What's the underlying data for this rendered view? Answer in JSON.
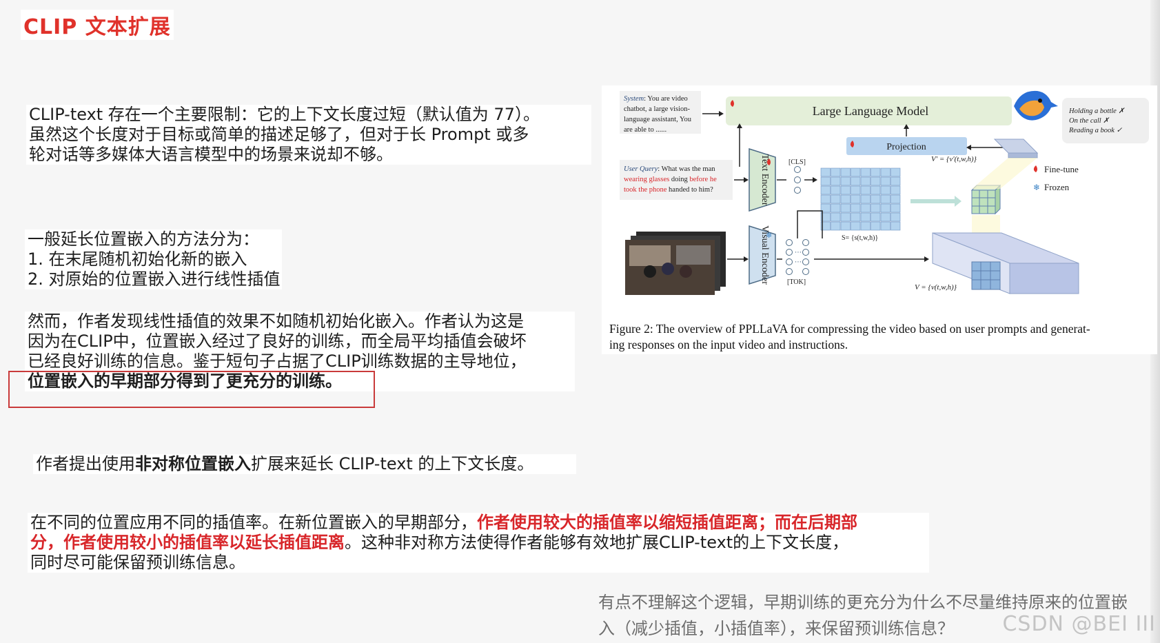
{
  "slide": {
    "title": "CLIP 文本扩展",
    "p1": {
      "lines": [
        "CLIP-text 存在一个主要限制：它的上下文长度过短（默认值为 77）。",
        "虽然这个长度对于目标或简单的描述足够了，但对于长 Prompt 或多",
        "轮对话等多媒体大语言模型中的场景来说却不够。"
      ]
    },
    "p2": {
      "lines": [
        "一般延长位置嵌入的方法分为：",
        "1. 在末尾随机初始化新的嵌入",
        "2.  对原始的位置嵌入进行线性插值"
      ]
    },
    "p3": {
      "lines": [
        "然而，作者发现线性插值的效果不如随机初始化嵌入。作者认为这是",
        "因为在CLIP中，位置嵌入经过了良好的训练，而全局平均插值会破坏",
        "已经良好训练的信息。鉴于短句子占据了CLIP训练数据的主导地位，"
      ],
      "bold_line": "位置嵌入的早期部分得到了更充分的训练。"
    },
    "p4": {
      "prefix": "作者提出使用",
      "bold": "非对称位置嵌入",
      "suffix": "扩展来延长 CLIP-text 的上下文长度。"
    },
    "p5": {
      "part1": "在不同的位置应用不同的插值率。在新位置嵌入的早期部分，",
      "red1": "作者使用较大的插值率以缩短插值距离；而在后期部",
      "red2": "分，作者使用较小的插值率以延长插值距离",
      "part2": "。这种非对称方法使得作者能够有效地扩展CLIP-text的上下文长度，",
      "line3": "同时尽可能保留预训练信息。"
    },
    "note": {
      "lines": [
        "有点不理解这个逻辑，早期训练的更充分为什么不尽量维持原来的位置嵌",
        "入（减少插值，小插值率），来保留预训练信息？"
      ]
    },
    "watermark": "CSDN @BEI III"
  },
  "figure": {
    "system_box": {
      "label": "System",
      "lines": [
        ": You are video",
        "chatbot, a large vision-",
        "language assistant, You",
        "are able to   ......"
      ]
    },
    "llm_label": "Large  Language Model",
    "projection_label": "Projection",
    "text_encoder_label": "Text Encoder",
    "visual_encoder_label": "Visual Encoder",
    "cls_label": "[CLS]",
    "tok_label": "[TOK]",
    "query_box": {
      "label": "User Query",
      "line1_rest": ": What was the man",
      "line2_red1": "wearing glasses",
      "line2_mid": " doing ",
      "line2_red2": "before he",
      "line3_red": "took the phone",
      "line3_rest": " handed to him?"
    },
    "answer_box": {
      "lines": [
        "Holding a bottle ✗",
        "On the call ✗",
        "Reading a book ✓"
      ]
    },
    "s_label": "S= {s(t,w,h)}",
    "vprime_label": "V' = {v'(t,w,h)}",
    "v_label": "V = {v(t,w,h)}",
    "legend": [
      {
        "icon": "fire-icon",
        "label": "Fine-tune",
        "color": "#e0322b"
      },
      {
        "icon": "snowflake-icon",
        "label": "Frozen",
        "color": "#3b82c4"
      }
    ],
    "caption_lines": [
      "Figure 2: The overview of PPLLaVA for compressing the video based on user prompts and generat-",
      "ing responses on the input video and instructions."
    ],
    "colors": {
      "llm_fill": "#e4efd9",
      "projection_fill": "#b9d4ef",
      "grid_fill": "#b3d3ee",
      "cube_green": "#bfe2bd",
      "cube_blue": "#8fb5dd",
      "encoder_fill": "#d6e8d2",
      "visual_encoder_fill": "#cfe0ef",
      "accent_red": "#e0322b"
    }
  }
}
